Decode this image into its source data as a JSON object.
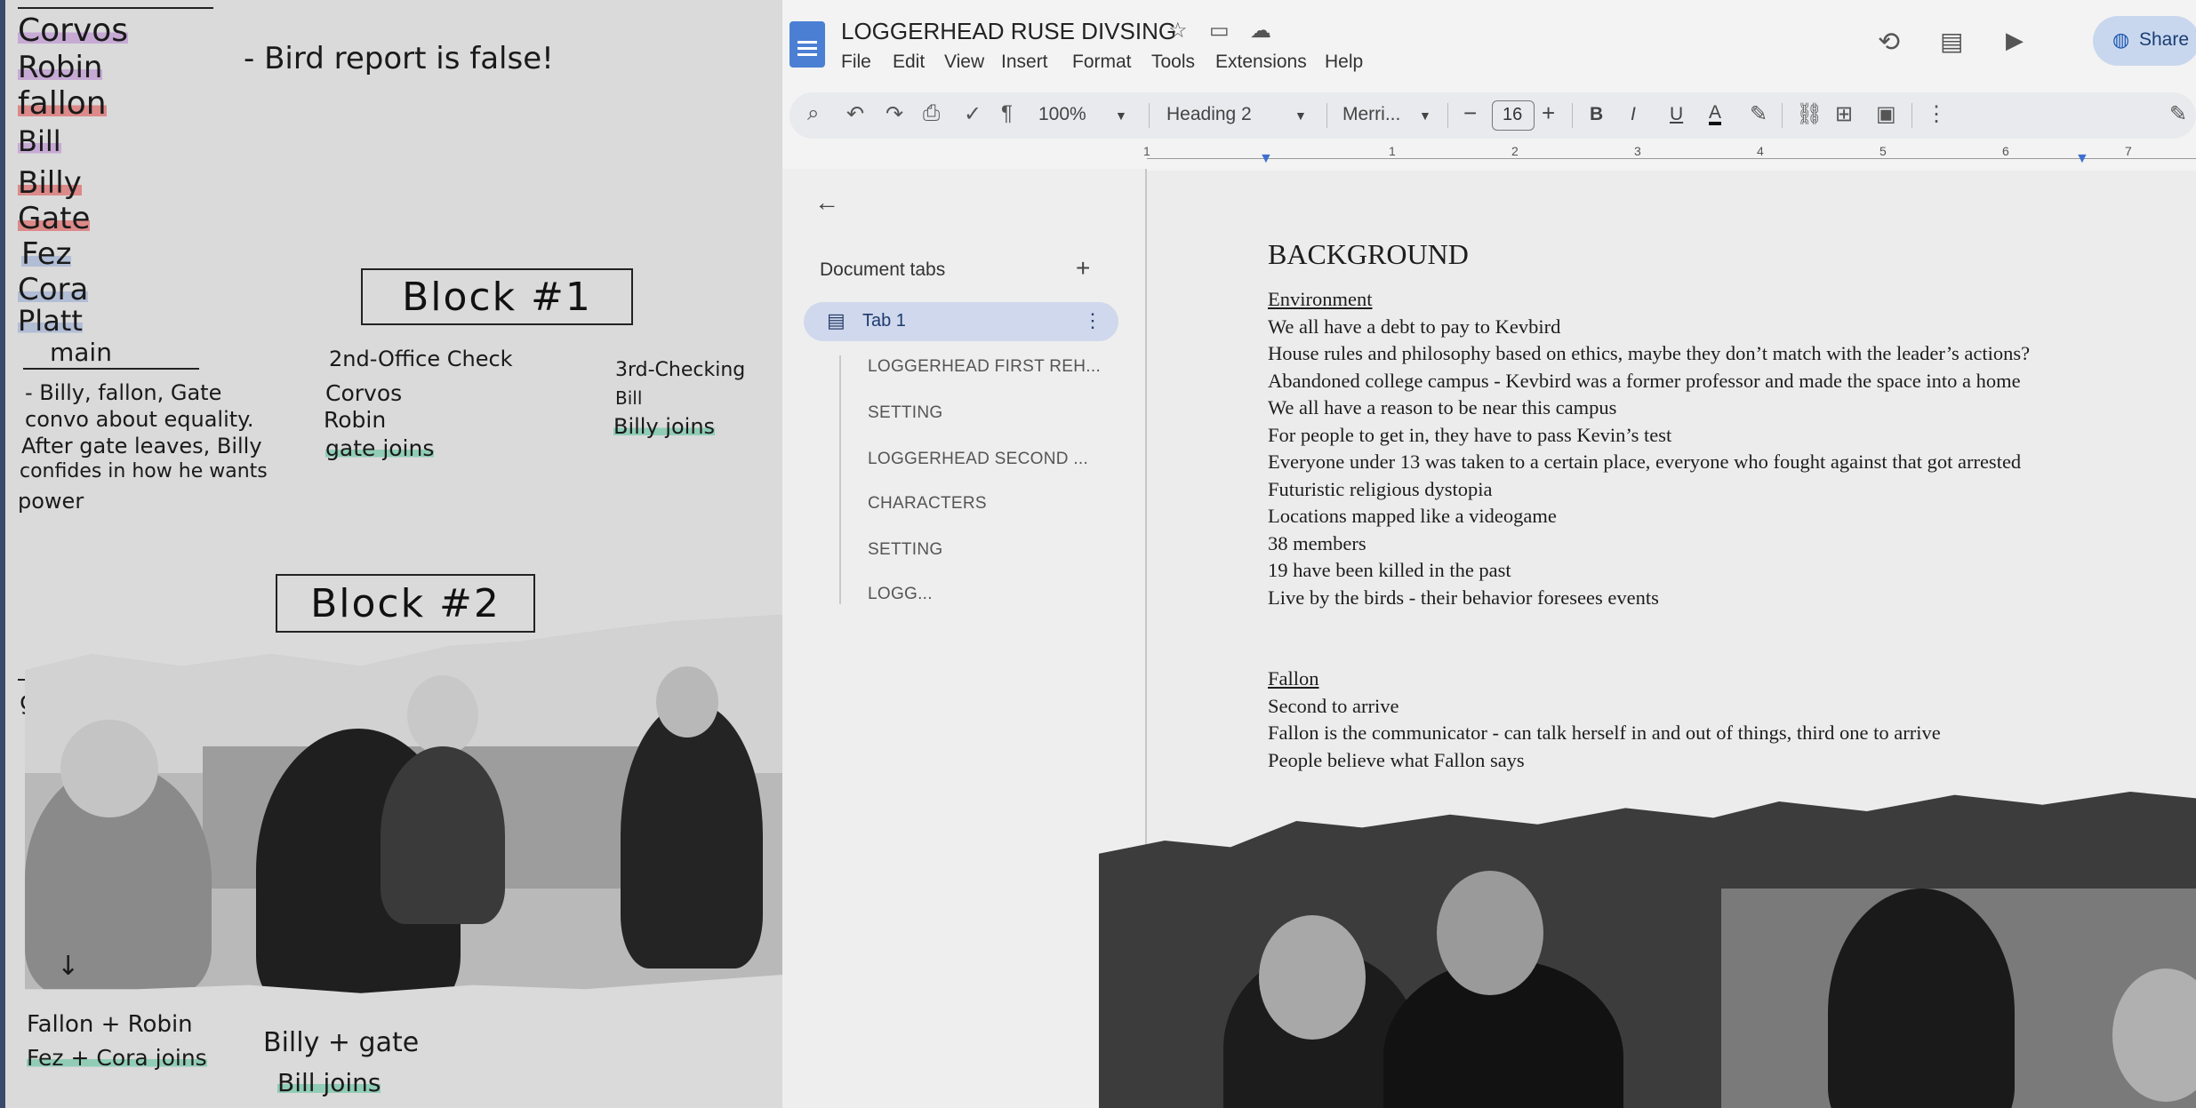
{
  "notes": {
    "names": [
      "Corvos",
      "Robin",
      "fallon",
      "Bill",
      "Billy",
      "Gate",
      "Fez",
      "Cora",
      "Platt"
    ],
    "top_note": "- Bird report is false!",
    "block1": "Block #1",
    "block2": "Block #2",
    "main_heading": "main",
    "main_text": [
      "- Billy, fallon, Gate",
      "convo about equality.",
      "After gate leaves, Billy",
      "confides in how he wants",
      "power"
    ],
    "office_check_heading": "2nd-Office Check",
    "office_check_items": [
      "Corvos",
      "Robin",
      "gate joins"
    ],
    "third_check_heading": "3rd-Checking",
    "third_check_items": [
      "Bill",
      "Billy joins"
    ],
    "gate_label": "gate",
    "bottom_left": [
      "Fallon + Robin",
      "Fez + Cora joins"
    ],
    "bottom_mid": [
      "Billy + gate",
      "Bill joins"
    ]
  },
  "docs": {
    "title": "LOGGERHEAD RUSE DIVSING",
    "menu": [
      "File",
      "Edit",
      "View",
      "Insert",
      "Format",
      "Tools",
      "Extensions",
      "Help"
    ],
    "share_label": "Share",
    "toolbar": {
      "zoom": "100%",
      "style": "Heading 2",
      "font": "Merri...",
      "font_size": "16",
      "bold": "B",
      "italic": "I",
      "underline": "U",
      "text_color": "A"
    },
    "ruler_numbers": [
      "1",
      "1",
      "2",
      "3",
      "4",
      "5",
      "6",
      "7"
    ],
    "sidebar": {
      "heading": "Document tabs",
      "add": "+",
      "tab1": "Tab 1",
      "outline": [
        "LOGGERHEAD FIRST REH...",
        "SETTING",
        "LOGGERHEAD SECOND ...",
        "CHARACTERS",
        "SETTING",
        "LOGG..."
      ]
    },
    "body": {
      "heading": "BACKGROUND",
      "section1": "Environment",
      "lines1": [
        "We all have a debt to pay to Kevbird",
        "House rules and philosophy based on ethics, maybe they don’t match with the leader’s actions?",
        "Abandoned college campus - Kevbird was a former professor and made the space into a home",
        "We all have a reason to be near this campus",
        "For people to get in, they have to pass Kevin’s test",
        "Everyone under 13 was taken to a certain place, everyone who fought against that got arrested",
        "Futuristic religious dystopia",
        "Locations mapped like a videogame",
        "38 members",
        "19 have been killed in the past",
        "Live by the birds - their behavior foresees events"
      ],
      "section2": "Fallon",
      "lines2": [
        "Second to arrive",
        "Fallon is the communicator - can talk herself in and out of things, third one to arrive",
        "People believe what Fallon says"
      ]
    }
  }
}
